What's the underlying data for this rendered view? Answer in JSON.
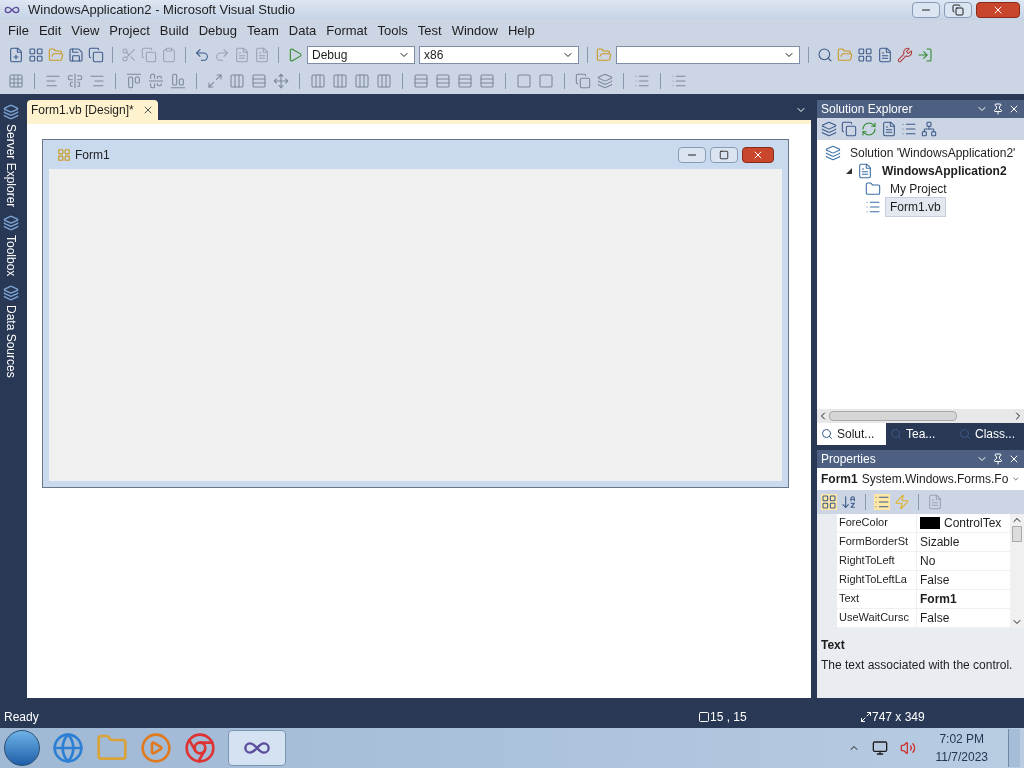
{
  "window": {
    "title": "WindowsApplication2 - Microsoft Visual Studio"
  },
  "menu": [
    "File",
    "Edit",
    "View",
    "Project",
    "Build",
    "Debug",
    "Team",
    "Data",
    "Format",
    "Tools",
    "Test",
    "Window",
    "Help"
  ],
  "toolbar": {
    "configuration": "Debug",
    "platform": "x86"
  },
  "side_tabs": [
    "Server Explorer",
    "Toolbox",
    "Data Sources"
  ],
  "document_tabs": [
    {
      "label": "Form1.vb [Design]*",
      "selected": true
    }
  ],
  "form": {
    "title": "Form1"
  },
  "solution_explorer": {
    "title": "Solution Explorer",
    "tree": [
      {
        "label": "Solution 'WindowsApplication2'",
        "kind": "solution",
        "bold": false,
        "selected": false,
        "children": [
          {
            "label": "WindowsApplication2",
            "kind": "project",
            "bold": true,
            "selected": false,
            "expanded": true,
            "children": [
              {
                "label": "My Project",
                "kind": "folder",
                "bold": false,
                "selected": false
              },
              {
                "label": "Form1.vb",
                "kind": "form",
                "bold": false,
                "selected": true
              }
            ]
          }
        ]
      }
    ],
    "tabs": [
      {
        "label": "Solut...",
        "selected": true
      },
      {
        "label": "Tea...",
        "selected": false
      },
      {
        "label": "Class...",
        "selected": false
      }
    ]
  },
  "properties": {
    "title": "Properties",
    "object": "Form1",
    "type": "System.Windows.Forms.Fo",
    "rows": [
      {
        "name": "ForeColor",
        "value": "ControlTex",
        "color": "#000000",
        "modified": false
      },
      {
        "name": "FormBorderSt",
        "value": "Sizable",
        "modified": false
      },
      {
        "name": "RightToLeft",
        "value": "No",
        "modified": false
      },
      {
        "name": "RightToLeftLa",
        "value": "False",
        "modified": false
      },
      {
        "name": "Text",
        "value": "Form1",
        "modified": true
      },
      {
        "name": "UseWaitCursc",
        "value": "False",
        "modified": false
      }
    ],
    "description": {
      "title": "Text",
      "text": "The text associated with the control."
    }
  },
  "status_bar": {
    "message": "Ready",
    "position": "15 , 15",
    "size": "747 x 349"
  },
  "taskbar": {
    "time": "7:02 PM",
    "date": "11/7/2023"
  }
}
